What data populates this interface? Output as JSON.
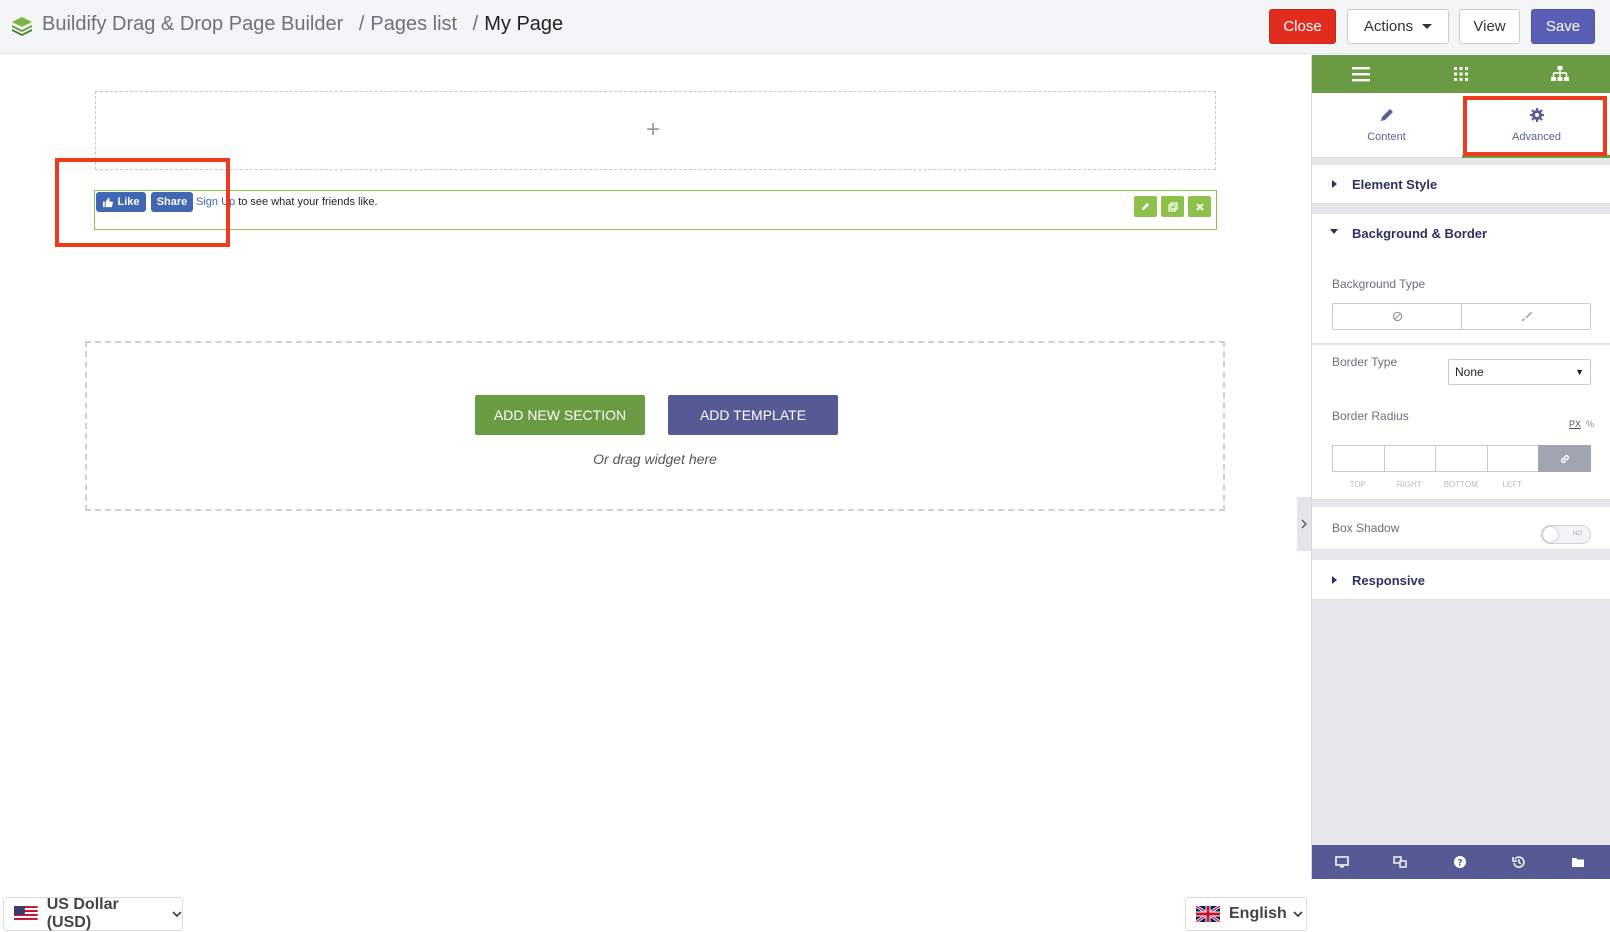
{
  "breadcrumb": {
    "app_title": "Buildify Drag & Drop Page Builder",
    "sep1": "/",
    "pages_list": "Pages list",
    "sep2": "/",
    "current_page": "My Page"
  },
  "toolbar": {
    "close_label": "Close",
    "actions_label": "Actions",
    "view_label": "View",
    "save_label": "Save"
  },
  "colors": {
    "close": "#e02d1e",
    "save": "#5a5fb5",
    "panel_green": "#6a9a42",
    "panel_purple": "#565a94",
    "highlight": "#f03a1d"
  },
  "canvas": {
    "add_icon": "+",
    "facebook_widget": {
      "like_label": "Like",
      "share_label": "Share",
      "signup_link": "Sign Up",
      "message": " to see what your friends like."
    },
    "drop_zone": {
      "add_section_label": "ADD NEW SECTION",
      "add_template_label": "ADD TEMPLATE",
      "hint": "Or drag widget here"
    }
  },
  "footer": {
    "currency": "US Dollar (USD)",
    "language": "English"
  },
  "panel": {
    "header_icons": [
      "menu-icon",
      "grid-icon",
      "navigator-icon"
    ],
    "tabs": [
      {
        "label": "Content",
        "icon": "pencil-icon"
      },
      {
        "label": "Advanced",
        "icon": "gear-icon",
        "active": true
      }
    ],
    "sections": {
      "element_style": "Element Style",
      "background_border": "Background & Border",
      "responsive": "Responsive"
    },
    "background_type_label": "Background Type",
    "border_type_label": "Border Type",
    "border_type_value": "None",
    "border_radius_label": "Border Radius",
    "units": {
      "px": "PX",
      "percent": "%"
    },
    "radius_sides": [
      "TOP",
      "RIGHT",
      "BOTTOM",
      "LEFT"
    ],
    "box_shadow_label": "Box Shadow",
    "box_shadow_toggle": "NO",
    "footer_icons": [
      "desktop-icon",
      "responsive-icon",
      "help-icon",
      "history-icon",
      "folder-icon"
    ]
  }
}
